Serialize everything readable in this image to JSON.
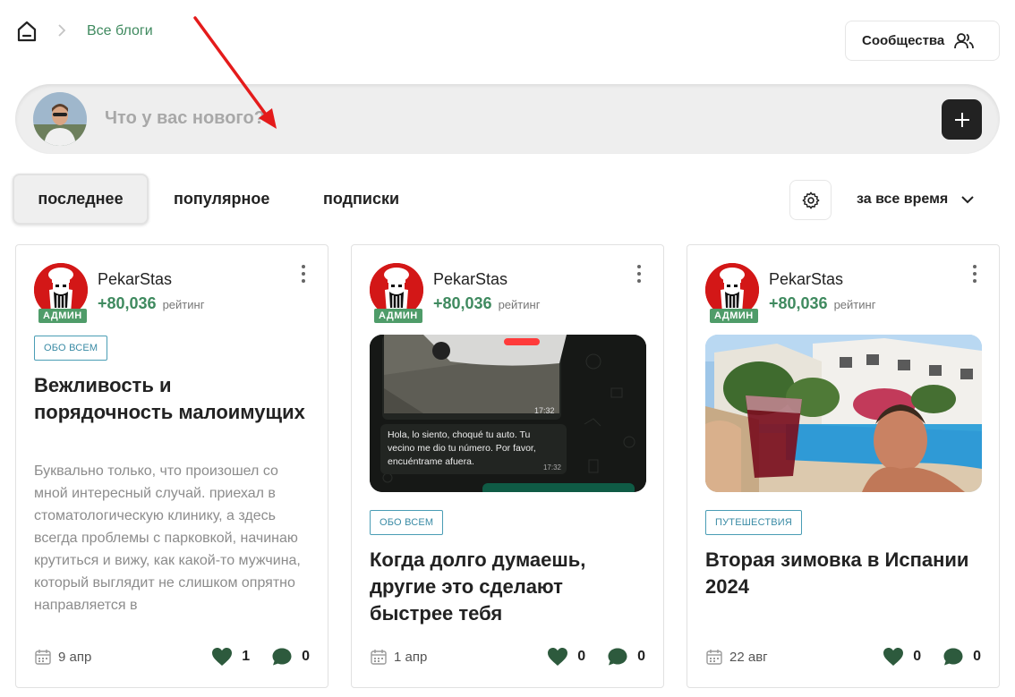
{
  "breadcrumb": {
    "label": "Все блоги"
  },
  "header": {
    "communities_label": "Сообщества"
  },
  "composer": {
    "placeholder": "Что у вас нового?"
  },
  "tabs": [
    {
      "label": "последнее",
      "active": true
    },
    {
      "label": "популярное",
      "active": false
    },
    {
      "label": "подписки",
      "active": false
    }
  ],
  "filter": {
    "period": "за все время"
  },
  "colors": {
    "accent_green": "#3f8a5f",
    "tag_blue": "#3a8ba5",
    "dark_button": "#222222"
  },
  "posts": [
    {
      "author": "PekarStas",
      "badge": "АДМИН",
      "rating": "+80,036",
      "rating_label": "рейтинг",
      "tag": "ОБО ВСЕМ",
      "title": "Вежливость и порядочность малоимущих",
      "excerpt": "Буквально только, что произошел со мной интересный случай. приехал в стоматологическую клинику, а здесь всегда проблемы с парковкой, начинаю крутиться и вижу, как какой-то мужчина, который выглядит не слишком опрятно направляется в",
      "date": "9 апр",
      "likes": "1",
      "comments": "0"
    },
    {
      "author": "PekarStas",
      "badge": "АДМИН",
      "rating": "+80,036",
      "rating_label": "рейтинг",
      "tag": "ОБО ВСЕМ",
      "title": "Когда долго думаешь, другие это сделают быстрее тебя",
      "image_chat": {
        "time1": "17:32",
        "message": "Hola, lo siento, choqué tu auto. Tu vecino me dio tu número. Por favor, encuéntrame afuera.",
        "time2": "17:32"
      },
      "date": "1 апр",
      "likes": "0",
      "comments": "0"
    },
    {
      "author": "PekarStas",
      "badge": "АДМИН",
      "rating": "+80,036",
      "rating_label": "рейтинг",
      "tag": "ПУТЕШЕСТВИЯ",
      "title": "Вторая зимовка в Испании 2024",
      "date": "22 авг",
      "likes": "0",
      "comments": "0"
    }
  ]
}
